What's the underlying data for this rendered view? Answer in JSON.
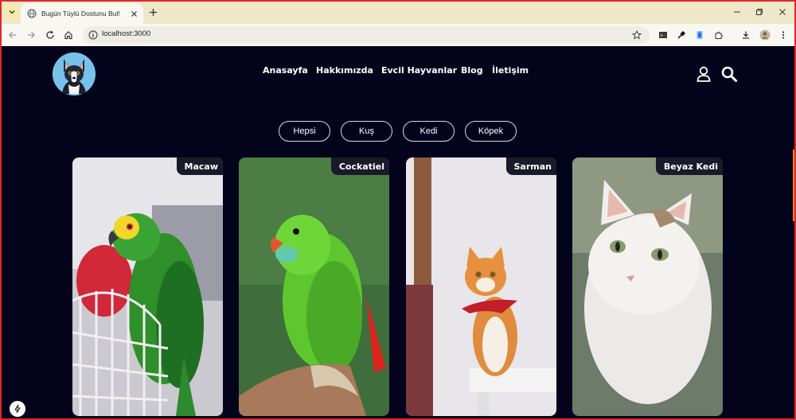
{
  "browser": {
    "tab_title": "Bugün Tüylü Dostunu Bul!",
    "url": "localhost:3000"
  },
  "site": {
    "nav": [
      {
        "label": "Anasayfa"
      },
      {
        "label": "Hakkımızda"
      },
      {
        "label": "Evcil Hayvanlar"
      },
      {
        "label": "Blog"
      },
      {
        "label": "İletişim"
      }
    ],
    "filters": [
      {
        "label": "Hepsi"
      },
      {
        "label": "Kuş"
      },
      {
        "label": "Kedi"
      },
      {
        "label": "Köpek"
      }
    ],
    "pets": [
      {
        "name": "Macaw"
      },
      {
        "name": "Cockatiel"
      },
      {
        "name": "Sarman"
      },
      {
        "name": "Beyaz Kedi"
      }
    ]
  },
  "colors": {
    "page_background": "#04031c",
    "tabbar": "#eee8c9",
    "frame": "#e0262b"
  }
}
